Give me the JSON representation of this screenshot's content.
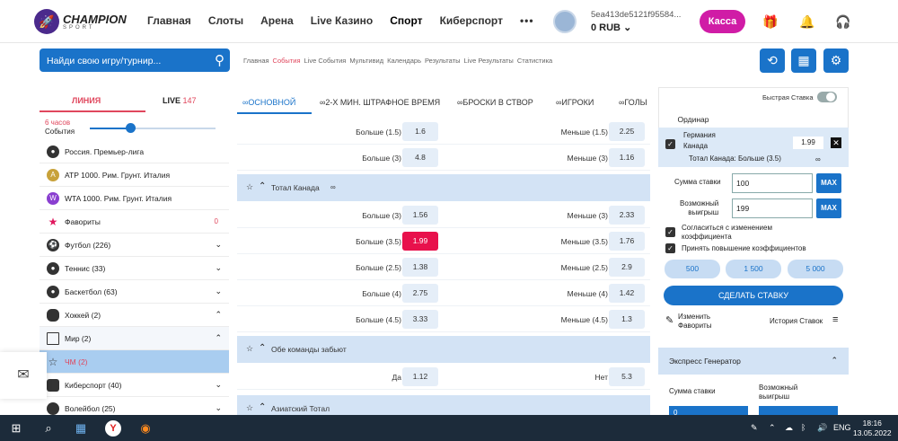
{
  "brand": {
    "name": "CHAMPION",
    "sub": "SPORT"
  },
  "nav": [
    "Главная",
    "Слоты",
    "Арена",
    "Live Казино",
    "Спорт",
    "Киберспорт",
    "•••"
  ],
  "account": {
    "id": "5ea413de5121f95584...",
    "balance": "0 RUB"
  },
  "kassa": "Касса",
  "search": {
    "placeholder": "Найди свою игру/турнир..."
  },
  "subnav": [
    "Главная",
    "События",
    "Live События",
    "Мультивид",
    "Календарь",
    "Результаты",
    "Live Результаты",
    "Статистика"
  ],
  "left": {
    "tab_line": "ЛИНИЯ",
    "tab_live": "LIVE",
    "live_count": "147",
    "slider_hours": "6 часов",
    "slider_events": "События",
    "items": [
      {
        "label": "Россия. Премьер-лига",
        "icon": "ball-icon"
      },
      {
        "label": "ATP 1000. Рим. Грунт. Италия",
        "icon": "atp-icon"
      },
      {
        "label": "WTA 1000. Рим. Грунт. Италия",
        "icon": "wta-icon"
      },
      {
        "label": "Фавориты",
        "count": "0",
        "icon": "star-icon"
      },
      {
        "label": "Футбол (226)",
        "icon": "football-icon"
      },
      {
        "label": "Теннис (33)",
        "icon": "tennis-icon"
      },
      {
        "label": "Баскетбол (63)",
        "icon": "basketball-icon"
      },
      {
        "label": "Хоккей (2)",
        "icon": "hockey-icon"
      },
      {
        "label": "Мир (2)",
        "icon": "map-icon"
      },
      {
        "label": "ЧМ (2)",
        "icon": "star-icon"
      },
      {
        "label": "Киберспорт (40)",
        "icon": "gamepad-icon"
      },
      {
        "label": "Волейбол (25)",
        "icon": "volleyball-icon"
      }
    ]
  },
  "tabs": [
    "ОСНОВНОЙ",
    "2-Х МИН. ШТРАФНОЕ ВРЕМЯ",
    "БРОСКИ В СТВОР",
    "ИГРОКИ",
    "ГОЛЫ"
  ],
  "rows_top": [
    {
      "l": "Больше (1.5)",
      "lv": "1.6",
      "r": "Меньше (1.5)",
      "rv": "2.25"
    },
    {
      "l": "Больше (3)",
      "lv": "4.8",
      "r": "Меньше (3)",
      "rv": "1.16"
    }
  ],
  "sec1": "Тотал Канада",
  "rows_canada": [
    {
      "l": "Больше (3)",
      "lv": "1.56",
      "r": "Меньше (3)",
      "rv": "2.33"
    },
    {
      "l": "Больше (3.5)",
      "lv": "1.99",
      "r": "Меньше (3.5)",
      "rv": "1.76"
    },
    {
      "l": "Больше (2.5)",
      "lv": "1.38",
      "r": "Меньше (2.5)",
      "rv": "2.9"
    },
    {
      "l": "Больше (4)",
      "lv": "2.75",
      "r": "Меньше (4)",
      "rv": "1.42"
    },
    {
      "l": "Больше (4.5)",
      "lv": "3.33",
      "r": "Меньше (4.5)",
      "rv": "1.3"
    }
  ],
  "sec2": "Обе команды забьют",
  "row_both": {
    "l": "Да",
    "lv": "1.12",
    "r": "Нет",
    "rv": "5.3"
  },
  "sec3": "Азиатский Тотал",
  "betslip": {
    "quick": "Быстрая Ставка",
    "tab": "Ординар",
    "team1": "Германия",
    "team2": "Канада",
    "coef": "1.99",
    "market": "Тотал Канада: Больше (3.5)",
    "stake_label": "Сумма ставки",
    "stake": "100",
    "win_label1": "Возможный",
    "win_label2": "выигрыш",
    "win": "199",
    "max": "MAX",
    "agree1a": "Согласиться с изменением",
    "agree1b": "коэффициента",
    "agree2": "Принять повышение коэффициентов",
    "quick_amounts": [
      "500",
      "1 500",
      "5 000"
    ],
    "place": "СДЕЛАТЬ СТАВКУ",
    "edit1": "Изменить",
    "edit2": "Фавориты",
    "history": "История Ставок"
  },
  "express": {
    "title": "Экспресс Генератор",
    "stake": "Сумма ставки",
    "win1": "Возможный",
    "win2": "выигрыш",
    "stake_val": "0"
  },
  "tray": {
    "lang": "ENG",
    "time": "18:16",
    "date": "13.05.2022"
  }
}
